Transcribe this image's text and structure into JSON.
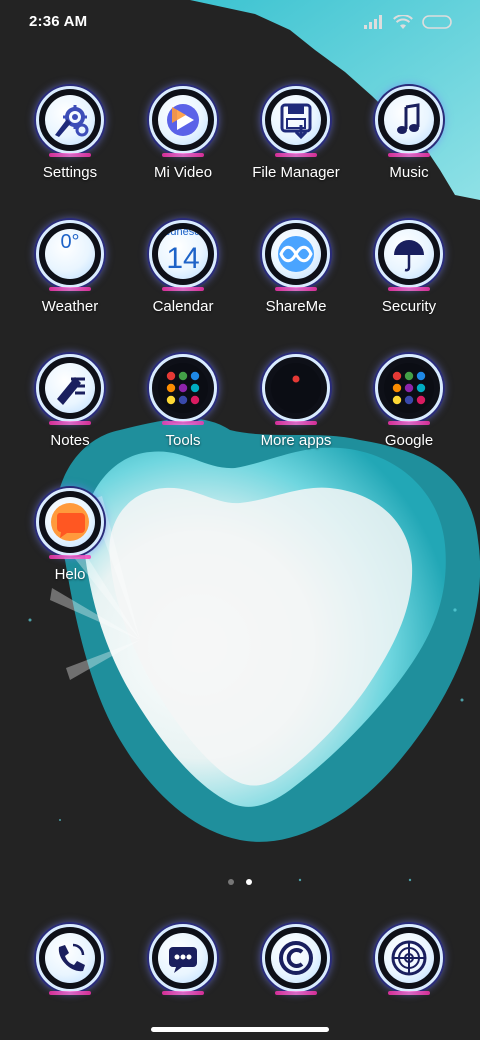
{
  "status_bar": {
    "time": "2:36 AM",
    "icons": [
      "signal-icon",
      "wifi-icon",
      "battery-icon"
    ]
  },
  "apps": [
    {
      "name": "settings",
      "label": "Settings",
      "icon": "gear-icon"
    },
    {
      "name": "mi-video",
      "label": "Mi Video",
      "icon": "play-icon"
    },
    {
      "name": "file-manager",
      "label": "File Manager",
      "icon": "floppy-icon"
    },
    {
      "name": "music",
      "label": "Music",
      "icon": "music-note-icon"
    },
    {
      "name": "weather",
      "label": "Weather",
      "icon": "weather-icon",
      "value": "0°"
    },
    {
      "name": "calendar",
      "label": "Calendar",
      "icon": "calendar-icon",
      "weekday": "Wednesday",
      "day": "14"
    },
    {
      "name": "shareme",
      "label": "ShareMe",
      "icon": "infinity-icon"
    },
    {
      "name": "security",
      "label": "Security",
      "icon": "umbrella-icon"
    },
    {
      "name": "notes",
      "label": "Notes",
      "icon": "pen-icon"
    },
    {
      "name": "tools",
      "label": "Tools",
      "icon": "folder-grid-icon"
    },
    {
      "name": "more-apps",
      "label": "More apps",
      "icon": "folder-icon"
    },
    {
      "name": "google",
      "label": "Google",
      "icon": "folder-grid-icon"
    },
    {
      "name": "helo",
      "label": "Helo",
      "icon": "helo-icon"
    }
  ],
  "page_indicator": {
    "count": 2,
    "active": 1
  },
  "dock": [
    {
      "name": "phone",
      "icon": "phone-icon"
    },
    {
      "name": "messages",
      "icon": "chat-icon"
    },
    {
      "name": "browser",
      "icon": "copyright-icon"
    },
    {
      "name": "camera",
      "icon": "aperture-icon"
    }
  ],
  "colors": {
    "accent": "#4fd8e8",
    "ring": "#d9ecff",
    "glow": "#ff2fb0"
  }
}
